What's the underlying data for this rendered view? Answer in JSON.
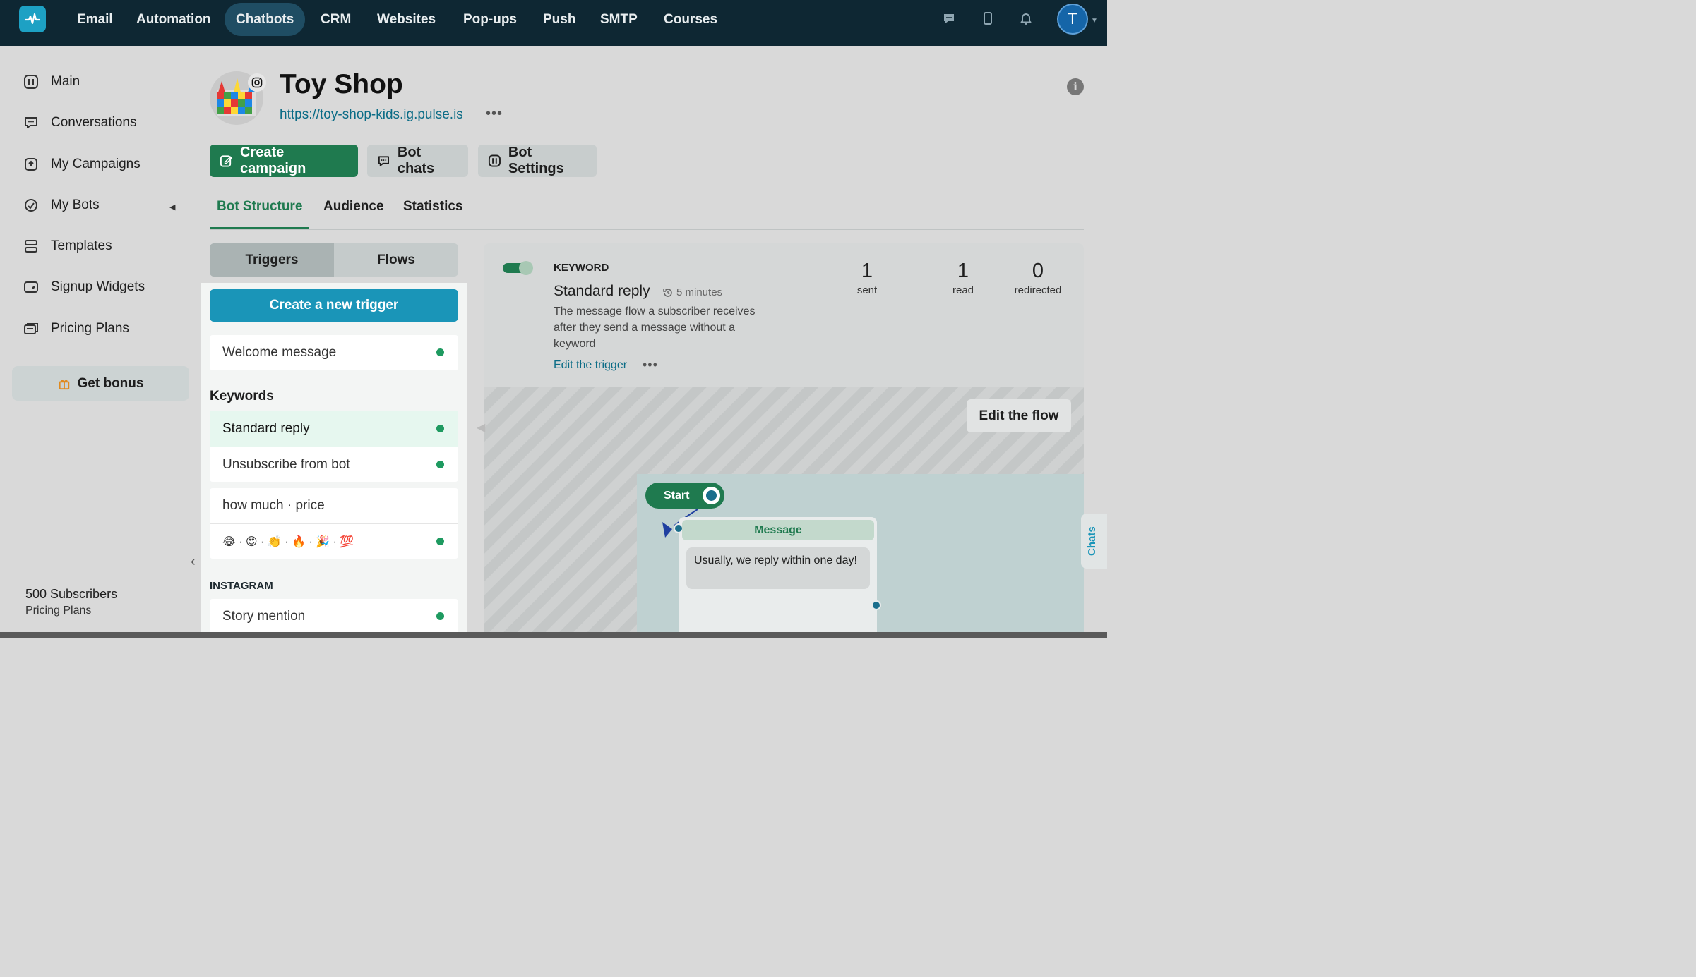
{
  "nav": {
    "items": [
      "Email",
      "Automation",
      "Chatbots",
      "CRM",
      "Websites",
      "Pop-ups",
      "Push",
      "SMTP",
      "Courses"
    ],
    "active": "Chatbots",
    "avatar_letter": "T",
    "icons": [
      "chat-icon",
      "mobile-icon",
      "bell-icon"
    ]
  },
  "sidebar": {
    "items": [
      {
        "label": "Main",
        "icon": "dashboard-icon"
      },
      {
        "label": "Conversations",
        "icon": "chat-icon"
      },
      {
        "label": "My Campaigns",
        "icon": "campaign-icon"
      },
      {
        "label": "My Bots",
        "icon": "bot-icon"
      },
      {
        "label": "Templates",
        "icon": "templates-icon"
      },
      {
        "label": "Signup Widgets",
        "icon": "widget-icon"
      },
      {
        "label": "Pricing Plans",
        "icon": "pricing-icon"
      }
    ],
    "bonus_label": "Get bonus",
    "subscribers": "500 Subscribers",
    "pricing_link": "Pricing Plans"
  },
  "bot": {
    "title": "Toy Shop",
    "url": "https://toy-shop-kids.ig.pulse.is",
    "more": "•••"
  },
  "actions": {
    "create_campaign": "Create campaign",
    "bot_chats": "Bot chats",
    "bot_settings": "Bot Settings"
  },
  "tabs": [
    "Bot Structure",
    "Audience",
    "Statistics"
  ],
  "segment": {
    "triggers": "Triggers",
    "flows": "Flows"
  },
  "triggers": {
    "create_label": "Create a new trigger",
    "welcome": "Welcome message",
    "keywords_title": "Keywords",
    "keywords": [
      "Standard reply",
      "Unsubscribe from bot"
    ],
    "custom": [
      "how much · price",
      "😂 · 😍 · 👏 · 🔥 · 🎉 · 💯"
    ],
    "instagram_title": "INSTAGRAM",
    "instagram": [
      "Story mention"
    ]
  },
  "detail": {
    "type": "KEYWORD",
    "name": "Standard reply",
    "time": "5 minutes",
    "description": "The message flow a subscriber receives after they send a message without a keyword",
    "edit_trigger": "Edit the trigger",
    "more": "•••",
    "stats": [
      {
        "num": "1",
        "label": "sent"
      },
      {
        "num": "1",
        "label": "read"
      },
      {
        "num": "0",
        "label": "redirected"
      }
    ]
  },
  "flow": {
    "edit_label": "Edit the flow",
    "start_label": "Start",
    "message_title": "Message",
    "message_text": "Usually, we reply within one day!"
  },
  "chats_tab": "Chats",
  "colors": {
    "nav_bg": "#0e2733",
    "brand_green": "#1f7a4f",
    "brand_blue": "#1a95b8"
  }
}
